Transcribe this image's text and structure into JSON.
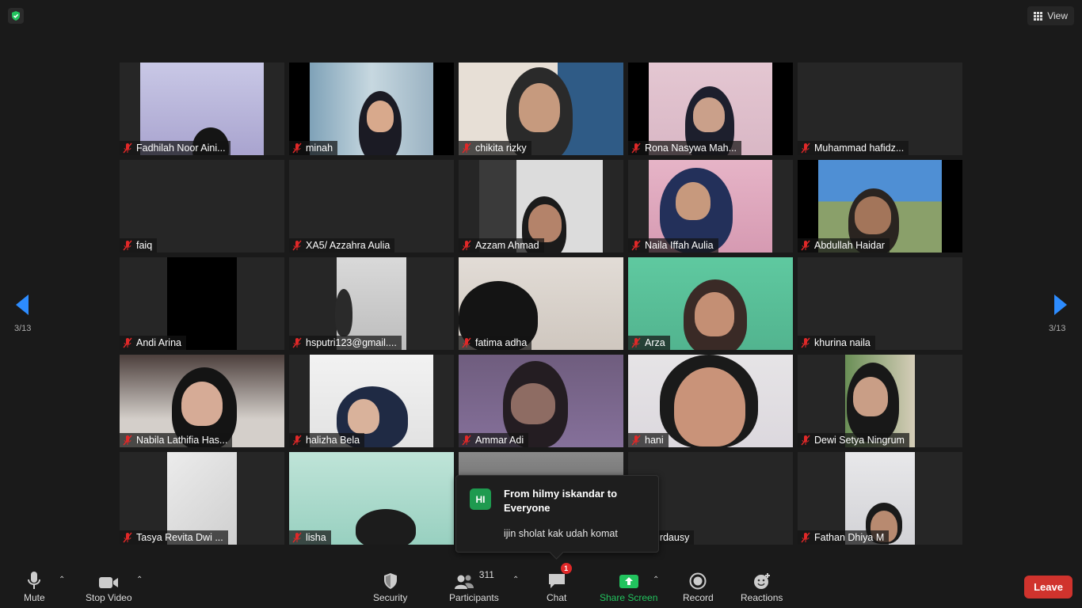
{
  "top": {
    "view_label": "View",
    "page_indicator": "3/13"
  },
  "participants": [
    {
      "name": "Fadhilah Noor Aini..."
    },
    {
      "name": "minah"
    },
    {
      "name": "chikita rizky"
    },
    {
      "name": "Rona Nasywa Mah..."
    },
    {
      "name": "Muhammad hafidz..."
    },
    {
      "name": "faiq"
    },
    {
      "name": "XA5/  Azzahra Aulia"
    },
    {
      "name": "Azzam Ahmad"
    },
    {
      "name": "Naila Iffah Aulia"
    },
    {
      "name": "Abdullah Haidar"
    },
    {
      "name": "Andi Arina"
    },
    {
      "name": "hsputri123@gmail...."
    },
    {
      "name": "fatima adha"
    },
    {
      "name": " Arza"
    },
    {
      "name": "khurina naila"
    },
    {
      "name": "Nabila Lathifia Has..."
    },
    {
      "name": "halizha Bela"
    },
    {
      "name": "Ammar Adi"
    },
    {
      "name": "hani"
    },
    {
      "name": "Dewi Setya Ningrum"
    },
    {
      "name": "Tasya Revita Dwi ..."
    },
    {
      "name": "lisha"
    },
    {
      "name": ""
    },
    {
      "name": "nisa Firdausy"
    },
    {
      "name": "Fathan Dhiya M"
    }
  ],
  "chat_notification": {
    "avatar_initials": "HI",
    "from": "From hilmy iskandar to Everyone",
    "message": "ijin sholat kak udah komat"
  },
  "toolbar": {
    "mute": "Mute",
    "stop_video": "Stop Video",
    "security": "Security",
    "participants": "Participants",
    "participants_count": "311",
    "chat": "Chat",
    "chat_badge": "1",
    "share_screen": "Share Screen",
    "record": "Record",
    "reactions": "Reactions",
    "leave": "Leave"
  },
  "colors": {
    "share_green": "#22c35e",
    "leave_red": "#d0332d",
    "nav_blue": "#2d8cff",
    "muted_red": "#e02828"
  }
}
